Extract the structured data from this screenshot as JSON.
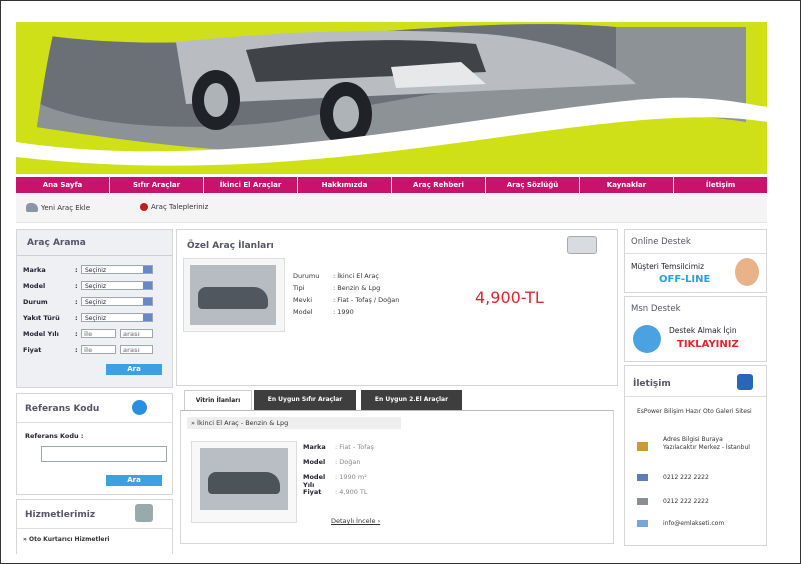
{
  "nav": [
    "Ana Sayfa",
    "Sıfır Araçlar",
    "İkinci El Araçlar",
    "Hakkımızda",
    "Araç Rehberi",
    "Araç Sözlüğü",
    "Kaynaklar",
    "İletişim"
  ],
  "subbar": {
    "new_car": "Yeni Araç Ekle",
    "requests": "Araç Talepleriniz"
  },
  "search": {
    "title": "Araç Arama",
    "fields": [
      {
        "label": "Marka",
        "value": "Seçiniz"
      },
      {
        "label": "Model",
        "value": "Seçiniz"
      },
      {
        "label": "Durum",
        "value": "Seçiniz"
      },
      {
        "label": "Yakıt Türü",
        "value": "Seçiniz"
      },
      {
        "label": "Model Yılı",
        "from": "ile",
        "to": "arası"
      },
      {
        "label": "Fiyat",
        "from": "ile",
        "to": "arası"
      }
    ],
    "button": "Ara"
  },
  "reference": {
    "title": "Referans Kodu",
    "label": "Referans Kodu :",
    "button": "Ara"
  },
  "services": {
    "title": "Hizmetlerimiz",
    "first_item": "Oto Kurtarıcı Hizmetleri"
  },
  "special": {
    "title": "Özel Araç İlanları",
    "rows": [
      {
        "k": "Durumu",
        "v": ": İkinci El Araç"
      },
      {
        "k": "Tipi",
        "v": ": Benzin & Lpg"
      },
      {
        "k": "Mevki",
        "v": ": Fiat - Tofaş / Doğan"
      },
      {
        "k": "Model",
        "v": ": 1990"
      }
    ],
    "price": "4,900-TL"
  },
  "tabs": [
    "Vitrin İlanları",
    "En Uygun Sıfır Araçlar",
    "En Uygun 2.El Araçlar"
  ],
  "listing": {
    "heading": "» İkinci El Araç - Benzin & Lpg",
    "rows": [
      {
        "k": "Marka",
        "v": ": Fiat - Tofaş"
      },
      {
        "k": "Model",
        "v": ": Doğan"
      },
      {
        "k": "Model Yılı",
        "v": ": 1990 m²"
      },
      {
        "k": "Fiyat",
        "v": ": 4,900 TL"
      }
    ],
    "details": "Detaylı İncele"
  },
  "online": {
    "title": "Online Destek",
    "line1": "Müşteri Temsilcimiz",
    "line2": "OFF-LINE"
  },
  "msn": {
    "title": "Msn Destek",
    "line1": "Destek Almak İçin",
    "line2": "TIKLAYINIZ"
  },
  "contact": {
    "title": "İletişim",
    "company": "EsPower Bilişim Hazır Oto Galeri Sitesi",
    "address": "Adres Bilgisi Buraya Yazılacaktır Merkez - İstanbul",
    "phone": "0212 222 2222",
    "fax": "0212 222 2222",
    "email": "info@emlakseti.com"
  },
  "colors": {
    "accent": "#c8126b",
    "banner": "#cfe018",
    "button": "#3ba0e4",
    "price": "#e0242c"
  }
}
